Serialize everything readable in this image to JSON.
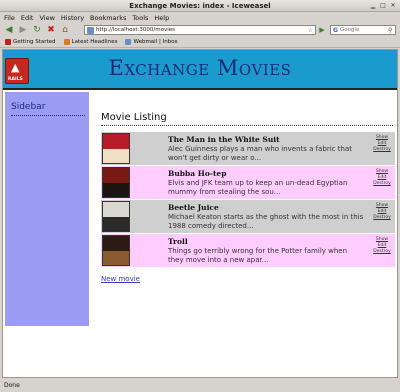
{
  "window": {
    "title": "Exchange Movies: index - Iceweasel"
  },
  "menu": [
    "File",
    "Edit",
    "View",
    "History",
    "Bookmarks",
    "Tools",
    "Help"
  ],
  "nav": {
    "url": "http://localhost:3000/movies",
    "search_placeholder": "Google"
  },
  "bookmarks": [
    {
      "label": "Getting Started",
      "color": "#c42020"
    },
    {
      "label": "Latest Headlines",
      "color": "#e07a20"
    },
    {
      "label": "Webmail | Inbox",
      "color": "#6b8fc1"
    }
  ],
  "page": {
    "site_title": "Exchange Movies",
    "logo_text": "RAILS",
    "sidebar_label": "Sidebar",
    "heading": "Movie Listing",
    "new_link": "New movie",
    "colors": {
      "header": "#199ccd",
      "sidebar": "#9c9cf4",
      "row_odd": "#cfcfcf",
      "row_even": "#ffcdff",
      "title_text": "#1e2a76"
    },
    "movies": [
      {
        "title": "The Man in the White Suit",
        "desc": "Alec Guinness plays a man who invents a fabric that won't get dirty or wear o...",
        "actions": [
          "Show",
          "Edit",
          "Destroy"
        ]
      },
      {
        "title": "Bubba Ho-tep",
        "desc": "Elvis and JFK team up to keep an un-dead Egyptian mummy from stealing the sou...",
        "actions": [
          "Show",
          "Edit",
          "Destroy"
        ]
      },
      {
        "title": "Beetle Juice",
        "desc": "Michael Keaton starts as the ghost with the most in this 1988 comedy directed...",
        "actions": [
          "Show",
          "Edit",
          "Destroy"
        ]
      },
      {
        "title": "Troll",
        "desc": "Things go terribly wrong for the Potter family when they move into a new apar...",
        "actions": [
          "Show",
          "Edit",
          "Destroy"
        ]
      }
    ]
  },
  "status": "Done"
}
